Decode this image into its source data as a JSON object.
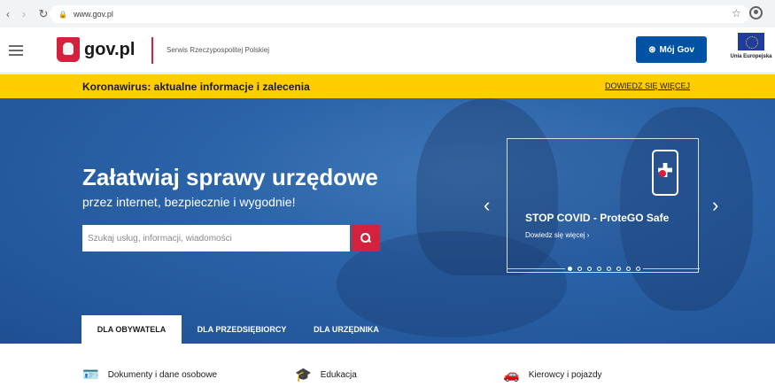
{
  "browser": {
    "url": "www.gov.pl",
    "back_icon": "back-arrow-icon",
    "forward_icon": "forward-arrow-icon",
    "reload_icon": "reload-icon"
  },
  "header": {
    "logo": "gov.pl",
    "service_name": "Serwis Rzeczypospolitej Polskiej",
    "moj_gov": "Mój Gov",
    "eu_label": "Unia Europejska"
  },
  "alert": {
    "text": "Koronawirus: aktualne informacje i zalecenia",
    "link": "DOWIEDZ SIĘ WIĘCEJ"
  },
  "hero": {
    "title": "Załatwiaj sprawy urzędowe",
    "subtitle": "przez internet, bezpiecznie i wygodnie!",
    "search_placeholder": "Szukaj usług, informacji, wiadomości"
  },
  "slider": {
    "title": "STOP COVID - ProteGO Safe",
    "link": "Dowiedz się więcej ›",
    "slide_count": 8,
    "active_slide": 1
  },
  "tabs": [
    "DLA OBYWATELA",
    "DLA PRZEDSIĘBIORCY",
    "DLA URZĘDNIKA"
  ],
  "categories": [
    "Dokumenty i dane osobowe",
    "Edukacja",
    "Kierowcy i pojazdy"
  ],
  "colors": {
    "brand_blue": "#0052a5",
    "alert_yellow": "#ffcd00",
    "brand_red": "#d4213d"
  }
}
